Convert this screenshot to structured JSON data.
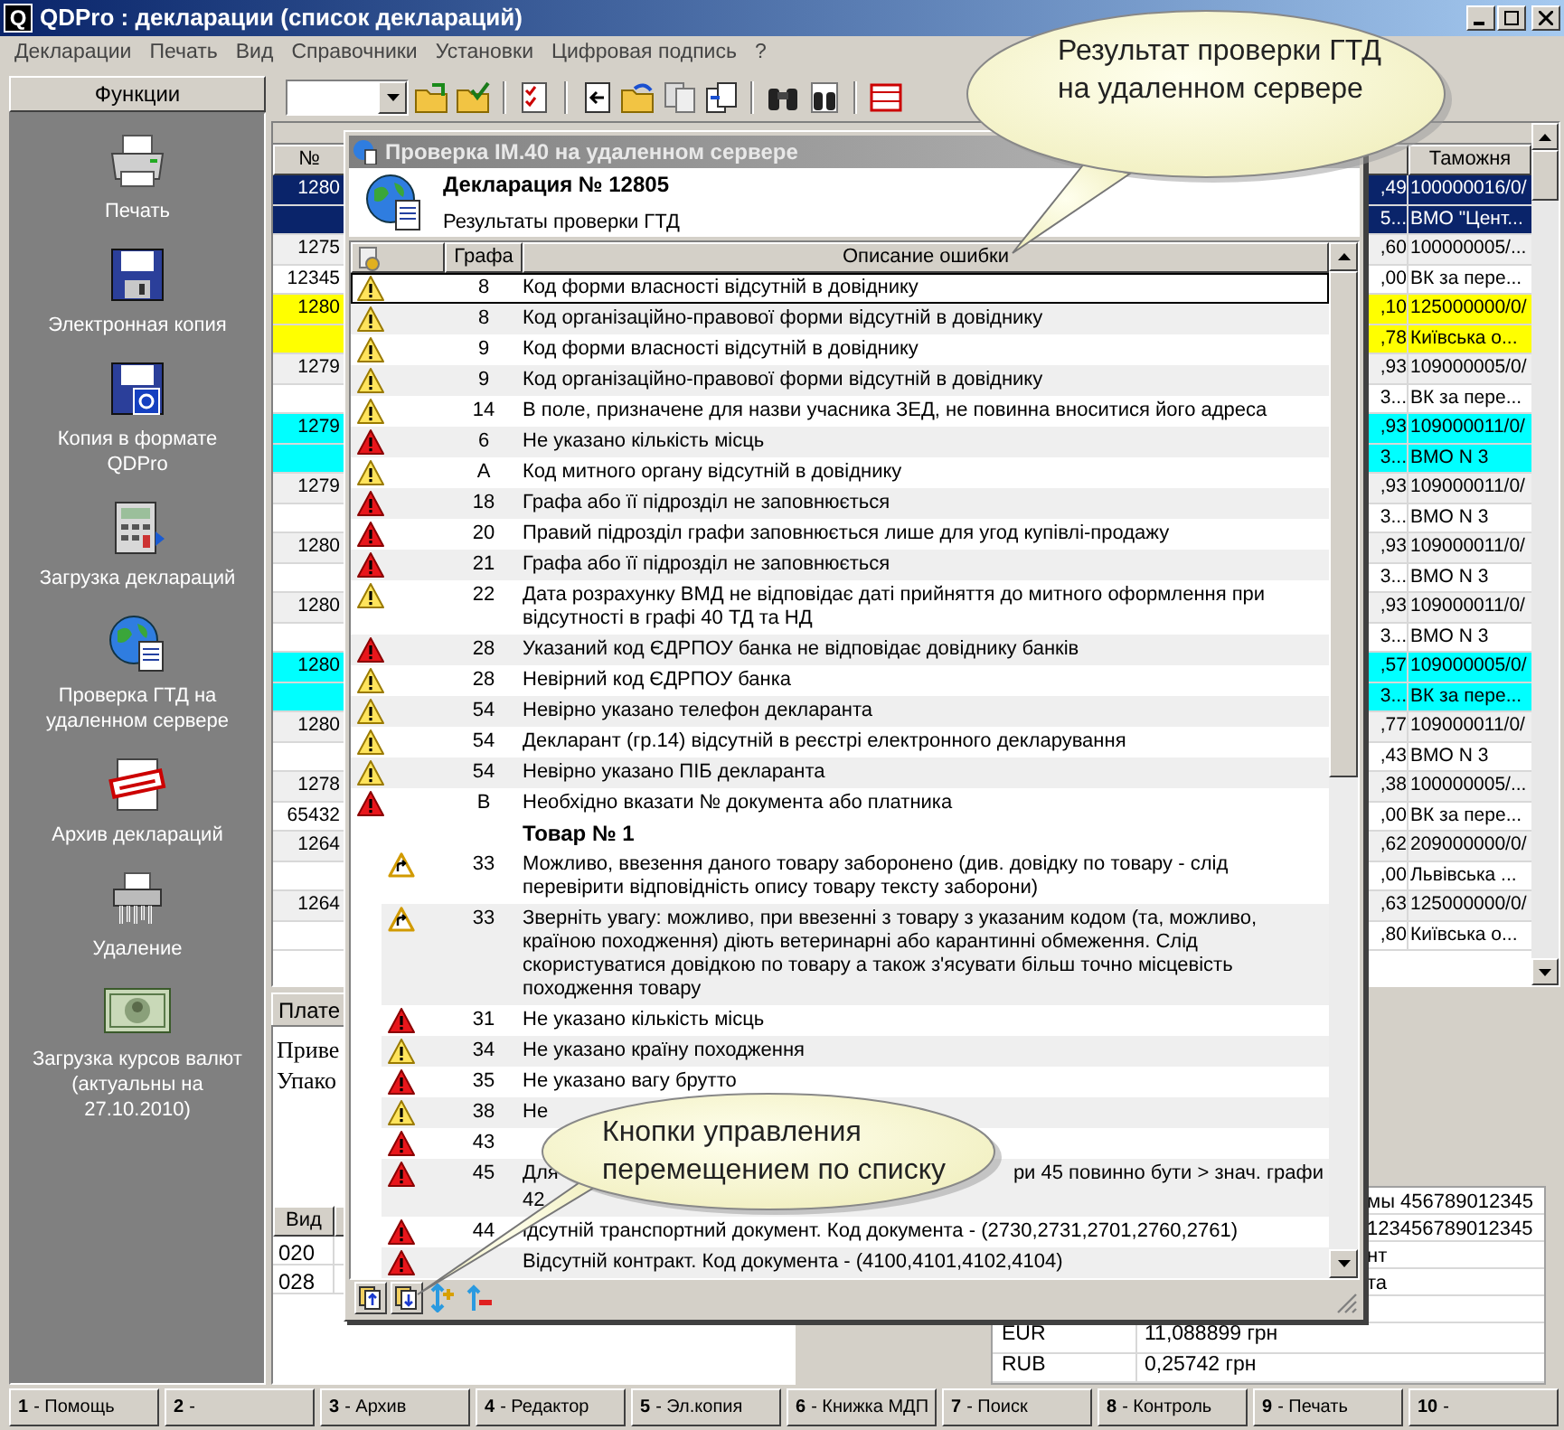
{
  "window": {
    "logo": "Q",
    "title": "QDPro : декларации (список деклараций)"
  },
  "menu": [
    "Декларации",
    "Печать",
    "Вид",
    "Справочники",
    "Установки",
    "Цифровая подпись",
    "?"
  ],
  "functions": {
    "title": "Функции",
    "items": [
      {
        "kind": "printer",
        "label": "Печать"
      },
      {
        "kind": "floppy",
        "label": "Электронная копия"
      },
      {
        "kind": "floppy-q",
        "label": "Копия в формате QDPro"
      },
      {
        "kind": "loader",
        "label": "Загрузка деклараций"
      },
      {
        "kind": "globe",
        "label": "Проверка ГТД на удаленном сервере"
      },
      {
        "kind": "archive",
        "label": "Архив деклараций"
      },
      {
        "kind": "shredder",
        "label": "Удаление"
      },
      {
        "kind": "banknote",
        "label": "Загрузка курсов валют (актуальны на 27.10.2010)"
      }
    ]
  },
  "grid": {
    "columns": [
      "№",
      "Таможня"
    ],
    "records": [
      {
        "selected": true,
        "lines": [
          {
            "num": "1280",
            "sum": ",49",
            "customs": "100000016/0/"
          },
          {
            "sum": "5...",
            "customs": "ВМО \"Цент..."
          }
        ]
      },
      {
        "selected": false,
        "lines": [
          {
            "num": "1275",
            "sum": ",60",
            "customs": "100000005/..."
          },
          {
            "num": "12345",
            "sum": ",00",
            "customs": "ВК за пере..."
          }
        ]
      },
      {
        "selected": false,
        "color": "#ffff00",
        "lines": [
          {
            "num": "1280",
            "sum": ",10",
            "customs": "125000000/0/"
          },
          {
            "sum": ",78",
            "customs": "Київська о..."
          }
        ]
      },
      {
        "selected": false,
        "lines": [
          {
            "num": "1279",
            "sum": ",93",
            "customs": "109000005/0/"
          },
          {
            "sum": "3...",
            "customs": "ВК за пере..."
          }
        ]
      },
      {
        "selected": false,
        "color": "#00ffff",
        "lines": [
          {
            "num": "1279",
            "sum": ",93",
            "customs": "109000011/0/"
          },
          {
            "sum": "3...",
            "customs": "ВМО N 3"
          }
        ]
      },
      {
        "selected": false,
        "lines": [
          {
            "num": "1279",
            "sum": ",93",
            "customs": "109000011/0/"
          },
          {
            "sum": "3...",
            "customs": "ВМО N 3"
          }
        ]
      },
      {
        "selected": false,
        "lines": [
          {
            "num": "1280",
            "sum": ",93",
            "customs": "109000011/0/"
          },
          {
            "sum": "3...",
            "customs": "ВМО N 3"
          }
        ]
      },
      {
        "selected": false,
        "lines": [
          {
            "num": "1280",
            "sum": ",93",
            "customs": "109000011/0/"
          },
          {
            "sum": "3...",
            "customs": "ВМО N 3"
          }
        ]
      },
      {
        "selected": false,
        "color": "#00ffff",
        "lines": [
          {
            "num": "1280",
            "sum": ",57",
            "customs": "109000005/0/"
          },
          {
            "sum": "3...",
            "customs": "ВК за пере..."
          }
        ]
      },
      {
        "selected": false,
        "lines": [
          {
            "num": "1280",
            "sum": ",77",
            "customs": "109000011/0/"
          },
          {
            "sum": ",43",
            "customs": "ВМО N 3"
          }
        ]
      },
      {
        "selected": false,
        "lines": [
          {
            "num": "1278",
            "sum": ",38",
            "customs": "100000005/..."
          },
          {
            "num": "65432",
            "sum": ",00",
            "customs": "ВК за пере..."
          }
        ]
      },
      {
        "selected": false,
        "lines": [
          {
            "num": "1264",
            "sum": ",62",
            "customs": "209000000/0/"
          },
          {
            "sum": ",00",
            "customs": "Львівська ..."
          }
        ]
      },
      {
        "selected": false,
        "lines": [
          {
            "num": "1264",
            "sum": ",63",
            "customs": "125000000/0/"
          },
          {
            "sum": ",80",
            "customs": "Київська о..."
          }
        ]
      }
    ]
  },
  "payment_panel": {
    "tab": "Плате",
    "text_lines": [
      "Приве",
      "Упако"
    ],
    "table": {
      "columns": [
        "Вид"
      ],
      "rows": [
        "020",
        "028"
      ]
    }
  },
  "rates_panel": {
    "partial_rows": [
      "мы 456789012345",
      "123456789012345",
      "нт",
      "та"
    ],
    "rows": [
      {
        "currency": "EUR",
        "rate": "11,088899 грн"
      },
      {
        "currency": "RUB",
        "rate": "0,25742 грн"
      }
    ]
  },
  "function_keys": [
    {
      "key": "1",
      "label": "- Помощь"
    },
    {
      "key": "2",
      "label": "-"
    },
    {
      "key": "3",
      "label": "- Архив"
    },
    {
      "key": "4",
      "label": "- Редактор"
    },
    {
      "key": "5",
      "label": "- Эл.копия"
    },
    {
      "key": "6",
      "label": "- Книжка МДП"
    },
    {
      "key": "7",
      "label": "- Поиск"
    },
    {
      "key": "8",
      "label": "- Контроль"
    },
    {
      "key": "9",
      "label": "- Печать"
    },
    {
      "key": "10",
      "label": "-"
    }
  ],
  "dialog": {
    "title": "Проверка IM.40 на удаленном сервере",
    "heading": "Декларация № 12805",
    "subheading": "Результаты проверки ГТД",
    "columns": [
      "Графа",
      "Описание ошибки"
    ],
    "rows": [
      {
        "kind": "warning",
        "graf": "8",
        "text": "Код форми власності відсутній в довіднику",
        "selected": true
      },
      {
        "kind": "warning",
        "graf": "8",
        "text": "Код організаційно-правової форми відсутній в довіднику",
        "selected": false
      },
      {
        "kind": "warning",
        "graf": "9",
        "text": "Код форми власності відсутній в довіднику",
        "selected": false
      },
      {
        "kind": "warning",
        "graf": "9",
        "text": "Код організаційно-правової форми відсутній в довіднику",
        "selected": false
      },
      {
        "kind": "warning",
        "graf": "14",
        "text": "В поле, призначене для назви учасника ЗЕД, не повинна вноситися його адреса",
        "selected": false
      },
      {
        "kind": "error",
        "graf": "6",
        "text": "Не указано кількість місць",
        "selected": false
      },
      {
        "kind": "warning",
        "graf": "А",
        "text": "Код митного органу відсутній в довіднику",
        "selected": false
      },
      {
        "kind": "error",
        "graf": "18",
        "text": "Графа або її підрозділ не заповнюється",
        "selected": false
      },
      {
        "kind": "error",
        "graf": "20",
        "text": "Правий підрозділ графи заповнюється лише для угод купівлі-продажу",
        "selected": false
      },
      {
        "kind": "error",
        "graf": "21",
        "text": "Графа або її підрозділ не заповнюється",
        "selected": false
      },
      {
        "kind": "warning",
        "graf": "22",
        "text": "Дата розрахунку ВМД не відповідає даті прийняття до митного оформлення при відсутності в графі 40 ТД та НД",
        "selected": false
      },
      {
        "kind": "error",
        "graf": "28",
        "text": "Указаний код ЄДРПОУ банка не відповідає довіднику банків",
        "selected": false
      },
      {
        "kind": "warning",
        "graf": "28",
        "text": "Невірний код ЄДРПОУ банка",
        "selected": false
      },
      {
        "kind": "warning",
        "graf": "54",
        "text": "Невірно указано телефон декларанта",
        "selected": false
      },
      {
        "kind": "warning",
        "graf": "54",
        "text": "Декларант (гр.14) відсутній в реєстрі електронного декларування",
        "selected": false
      },
      {
        "kind": "warning",
        "graf": "54",
        "text": "Невірно указано ПІБ декларанта",
        "selected": false
      },
      {
        "kind": "error",
        "graf": "В",
        "text": "Необхідно вказати № документа або платника",
        "selected": false
      },
      {
        "kind": "group",
        "text": "Товар № 1",
        "selected": false,
        "children": [
          {
            "kind": "notice",
            "graf": "33",
            "text": "Можливо, ввезення даного товару заборонено  (див. довідку по товару - слід перевірити відповідність опису товару тексту заборони)",
            "selected": false
          },
          {
            "kind": "notice",
            "graf": "33",
            "text": "Зверніть увагу: можливо, при ввезенні з товару з указаним кодом (та, можливо, країною походження) діють ветеринарні або карантинні обмеження. Слід скористуватися довідкою по товару а також з'ясувати більш точно місцевість походження товару",
            "selected": false
          },
          {
            "kind": "error",
            "graf": "31",
            "text": "Не указано кількість місць",
            "selected": false
          },
          {
            "kind": "warning",
            "graf": "34",
            "text": "Не указано країну походження",
            "selected": false
          },
          {
            "kind": "error",
            "graf": "35",
            "text": "Не указано вагу брутто",
            "selected": false
          },
          {
            "kind": "warning",
            "graf": "38",
            "text": "Не",
            "selected": false
          },
          {
            "kind": "error",
            "graf": "43",
            "selected": false
          },
          {
            "kind": "error",
            "graf": "45",
            "text": "Для",
            "text_tail": "ри 45 повинно бути > знач. графи",
            "text_line2": "42",
            "selected": false
          },
          {
            "kind": "error",
            "graf": "44",
            "text": "ідсутній транспортний документ. Код документа - (2730,2731,2701,2760,2761)",
            "selected": false
          },
          {
            "kind": "error",
            "text": "Відсутній контракт. Код документа - (4100,4101,4102,4104)",
            "selected": false
          }
        ]
      }
    ]
  },
  "callouts": [
    {
      "text": "Результат проверки ГТД на удаленном сервере"
    },
    {
      "text": "Кнопки управления перемещением по списку"
    }
  ]
}
